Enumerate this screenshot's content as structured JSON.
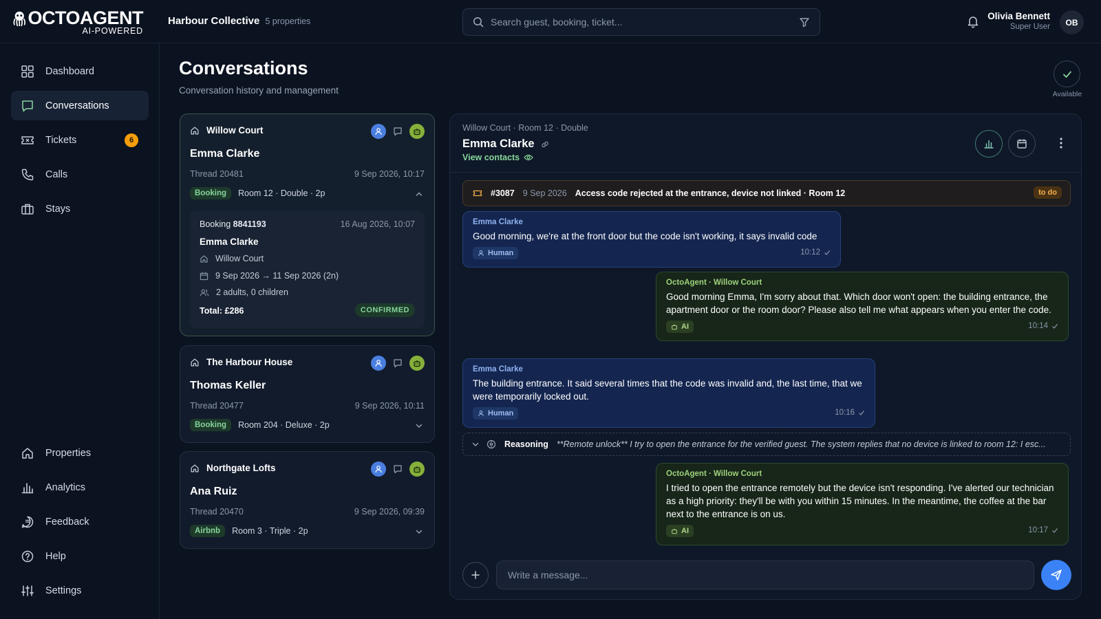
{
  "brand": {
    "name": "OCTOAGENT",
    "tagline": "AI-POWERED"
  },
  "org": {
    "name": "Harbour Collective",
    "count": "5 properties"
  },
  "search": {
    "placeholder": "Search guest, booking, ticket..."
  },
  "user": {
    "name": "Olivia Bennett",
    "role": "Super User",
    "initials": "OB"
  },
  "nav": {
    "top": [
      {
        "label": "Dashboard",
        "icon": "grid-icon"
      },
      {
        "label": "Conversations",
        "icon": "chat-icon",
        "active": true
      },
      {
        "label": "Tickets",
        "icon": "ticket-icon",
        "badge": "6"
      },
      {
        "label": "Calls",
        "icon": "phone-icon"
      },
      {
        "label": "Stays",
        "icon": "luggage-icon"
      }
    ],
    "bottom": [
      {
        "label": "Properties",
        "icon": "home-icon"
      },
      {
        "label": "Analytics",
        "icon": "bar-chart-icon"
      },
      {
        "label": "Feedback",
        "icon": "feedback-icon"
      },
      {
        "label": "Help",
        "icon": "help-icon"
      },
      {
        "label": "Settings",
        "icon": "sliders-icon"
      }
    ]
  },
  "page": {
    "title": "Conversations",
    "subtitle": "Conversation history and management",
    "status_label": "Available"
  },
  "threads": [
    {
      "property": "Willow Court",
      "guest": "Emma Clarke",
      "thread": "Thread 20481",
      "date": "9 Sep 2026, 10:17",
      "tag": "Booking",
      "room": "Room 12 · Double · 2p",
      "expanded": true,
      "booking": {
        "label": "Booking",
        "number": "8841193",
        "date": "16 Aug 2026, 10:07",
        "guest": "Emma Clarke",
        "property": "Willow Court",
        "dates": "9 Sep 2026 → 11 Sep 2026 (2n)",
        "party": "2 adults, 0 children",
        "total": "Total: £286",
        "status": "CONFIRMED"
      }
    },
    {
      "property": "The Harbour House",
      "guest": "Thomas Keller",
      "thread": "Thread 20477",
      "date": "9 Sep 2026, 10:11",
      "tag": "Booking",
      "room": "Room 204 · Deluxe · 2p"
    },
    {
      "property": "Northgate Lofts",
      "guest": "Ana Ruiz",
      "thread": "Thread 20470",
      "date": "9 Sep 2026, 09:39",
      "tag": "Airbnb",
      "room": "Room 3 · Triple · 2p"
    }
  ],
  "chat": {
    "breadcrumb": "Willow Court · Room 12 · Double",
    "guest": "Emma Clarke",
    "view_contacts": "View contacts",
    "ticket": {
      "number": "#3087",
      "date": "9 Sep 2026",
      "text": "Access code rejected at the entrance, device not linked · Room 12",
      "status": "to do"
    },
    "messages": [
      {
        "author": "Emma Clarke",
        "text": "Good morning, we're at the front door but the code isn't working, it says invalid code",
        "chip": "Human",
        "time": "10:12"
      },
      {
        "author": "OctoAgent · Willow Court",
        "text": "Good morning Emma, I'm sorry about that. Which door won't open: the building entrance, the apartment door or the room door? Please also tell me what appears when you enter the code.",
        "chip": "AI",
        "time": "10:14"
      },
      {
        "author": "Emma Clarke",
        "text": "The building entrance. It said several times that the code was invalid and, the last time, that we were temporarily locked out.",
        "chip": "Human",
        "time": "10:16"
      },
      {
        "author": "OctoAgent · Willow Court",
        "text": "I tried to open the entrance remotely but the device isn't responding. I've alerted our technician as a high priority: they'll be with you within 15 minutes. In the meantime, the coffee at the bar next to the entrance is on us.",
        "chip": "AI",
        "time": "10:17"
      }
    ],
    "reasoning": {
      "label": "Reasoning",
      "text": "**Remote unlock** I try to open the entrance for the verified guest. The system replies that no device is linked to room 12: I esc..."
    },
    "composer_placeholder": "Write a message..."
  },
  "colors": {
    "background": "#0b1220",
    "accent_green": "#86d49b",
    "guest_bubble": "#142650",
    "ai_bubble": "#172619",
    "badge_orange": "#f59e0b",
    "send_blue": "#3b82f6"
  }
}
